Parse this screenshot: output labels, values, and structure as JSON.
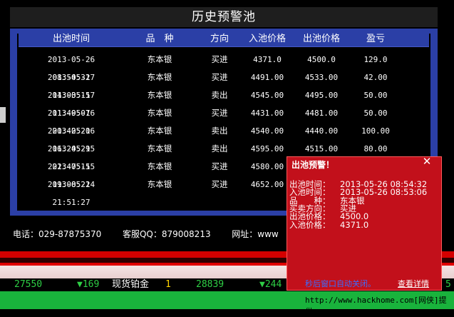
{
  "window": {
    "title": "历史预警池"
  },
  "table": {
    "headers": [
      "出池时间",
      "品　种",
      "方向",
      "入池价格",
      "出池价格",
      "盈亏"
    ],
    "rows": [
      [
        "2013-05-26 08:54:32",
        "东本银",
        "买进",
        "4371.0",
        "4500.0",
        "129.0"
      ],
      [
        "2013-05-17 14:03:15",
        "东本银",
        "买进",
        "4491.00",
        "4533.00",
        "42.00"
      ],
      [
        "2013-05-17 11:49:07",
        "东本银",
        "卖出",
        "4545.00",
        "4495.00",
        "50.00"
      ],
      [
        "2013-05-16 20:42:20",
        "东本银",
        "买进",
        "4431.00",
        "4481.00",
        "50.00"
      ],
      [
        "2013-05-16 16:24:29",
        "东本银",
        "卖出",
        "4540.00",
        "4440.00",
        "100.00"
      ],
      [
        "2013-05-15 22:47:15",
        "东本银",
        "卖出",
        "4595.00",
        "4515.00",
        "80.00"
      ],
      [
        "2013-05-15 19:08:22",
        "东本银",
        "买进",
        "4580.00",
        "",
        ""
      ],
      [
        "2013-05-14 21:51:27",
        "东本银",
        "买进",
        "4652.00",
        "",
        ""
      ]
    ]
  },
  "contact": {
    "phone": "电话：029-87875370",
    "qq": "客服QQ：879008213",
    "site": "网址：www"
  },
  "ticker": {
    "item1": "27550",
    "item2": "▼169",
    "item3": "现货铂金",
    "item4": "1",
    "item5": "28839",
    "item6": "▼244",
    "item7": "5"
  },
  "popup": {
    "title": "出池预警！",
    "close": "✕",
    "lines": [
      {
        "label": "出池时间：",
        "value": "2013-05-26 08:54:32"
      },
      {
        "label": "入池时间：",
        "value": "2013-05-26 08:53:06"
      },
      {
        "label": "品　　种：",
        "value": "东本银"
      },
      {
        "label": "买卖方向：",
        "value": "买进"
      },
      {
        "label": "出池价格：",
        "value": "4500.0"
      },
      {
        "label": "入池价格：",
        "value": "4371.0"
      }
    ],
    "auto_close": "秒后窗口自动关闭。",
    "view_detail": "查看详情"
  },
  "watermark": "http://www.hackhome.com[网侠]提供",
  "colors": {
    "frame_blue": "#2b3fa6",
    "popup_red": "#c2101b",
    "accent_green": "#19b33c",
    "alert_red": "#d40000"
  }
}
